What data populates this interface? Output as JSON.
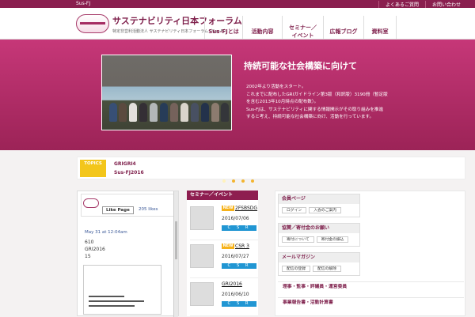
{
  "topbar": {
    "site": "Sus-FJ",
    "links": [
      "よくあるご質問",
      "お問い合わせ"
    ]
  },
  "header": {
    "brand": "サステナビリティ日本フォーラム",
    "subtitle": "特定非営利活動法人 サステナビリティ日本フォーラム（Sus-FJ）",
    "nav": [
      "Sus-FJとは",
      "活動内容",
      "セミナー／イベント",
      "広報ブログ",
      "資料室"
    ]
  },
  "hero": {
    "title": "持続可能な社会構築に向けて",
    "body": "2002年より活動をスタート。\nこれまでに配布したGRIガイドライン第3版（和訳版）3190冊（暫定版\nを含む2013年10月時点の配布数）。\nSus-FJは、サステナビリティに関する情報開示がその取り組みを推進\nすると考え、持続可能な社会構築に向け、活動を行っています。"
  },
  "topics": {
    "label": "TOPICS",
    "items": [
      "GRIGRI4",
      "Sus-FJ2016"
    ]
  },
  "left_feed": {
    "like_label": "Like Page",
    "likes": "205 likes",
    "date": "May 31 at 12:04am",
    "lines": [
      "610",
      "GRI2016",
      "15"
    ]
  },
  "mid": {
    "title": "セミナー／イベント",
    "events": [
      {
        "badge": "NEW",
        "title": "2FSBSDG",
        "date": "2016/07/06",
        "tag": "C S R"
      },
      {
        "badge": "NEW",
        "title": "CSR 3",
        "date": "2016/07/27",
        "tag": "C S R"
      },
      {
        "title": "GRI2016",
        "date": "2016/06/10",
        "tag": "C S R"
      }
    ]
  },
  "right": {
    "panels": [
      {
        "title": "会員ページ",
        "buttons": [
          "ログイン",
          "入会のご案内"
        ]
      },
      {
        "title": "協賛／寄付金のお願い",
        "buttons": [
          "寄付について",
          "寄付金の振込"
        ]
      },
      {
        "title": "メールマガジン",
        "buttons": [
          "配信の登録",
          "配信の解除"
        ]
      }
    ],
    "links": [
      "理事・監事・評議員・運営委員",
      "事業報告書・活動計算書"
    ]
  }
}
